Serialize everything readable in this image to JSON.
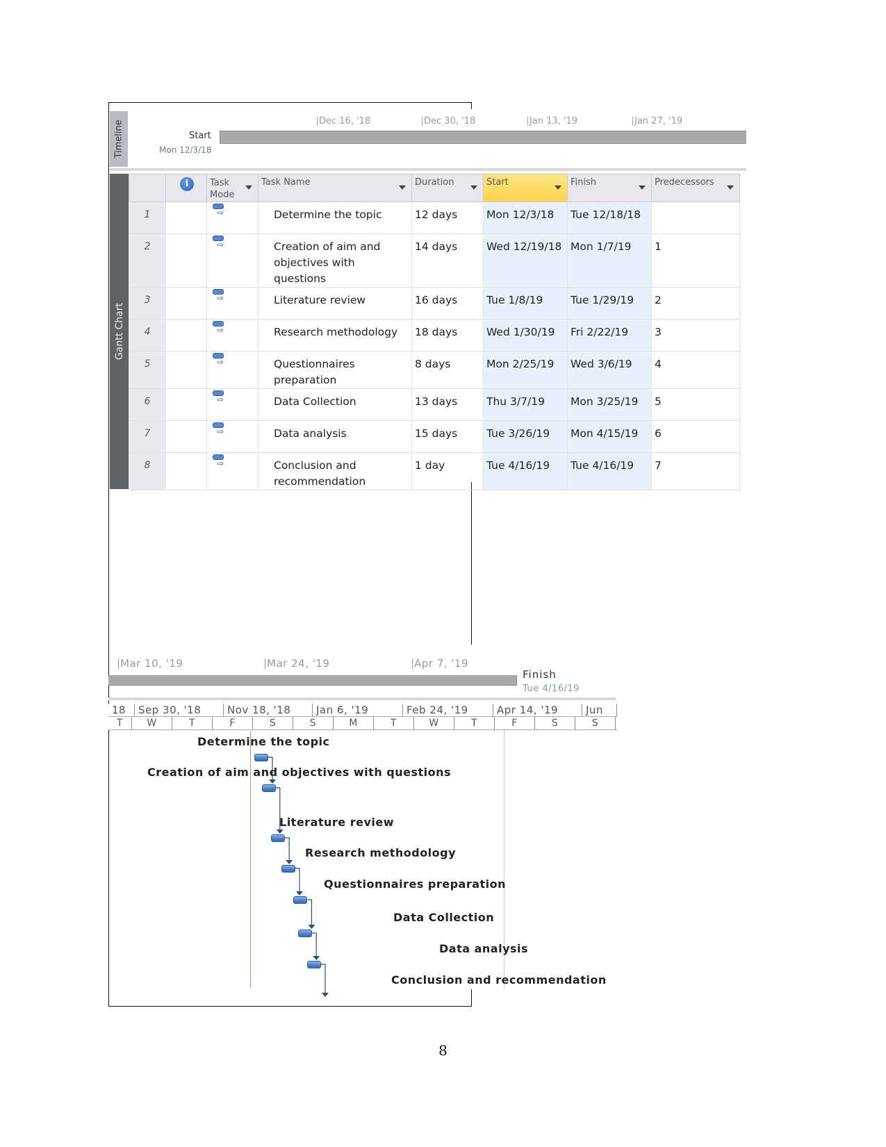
{
  "timeline": {
    "tab_label": "Timeline",
    "start_label": "Start",
    "start_date": "Mon 12/3/18",
    "ticks": [
      "Dec 16, '18",
      "Dec 30, '18",
      "Jan 13, '19",
      "Jan 27, '19"
    ],
    "lower_ticks": [
      "Mar 10, '19",
      "Mar 24, '19",
      "Apr 7, '19"
    ],
    "finish_label": "Finish",
    "finish_date": "Tue 4/16/19"
  },
  "gantt": {
    "tab_label": "Gantt Chart",
    "columns": {
      "info_icon": "i",
      "task_mode": "Task Mode",
      "task_name": "Task Name",
      "duration": "Duration",
      "start": "Start",
      "finish": "Finish",
      "predecessors": "Predecessors"
    },
    "rows": [
      {
        "id": "1",
        "name": "Determine the topic",
        "duration": "12 days",
        "start": "Mon 12/3/18",
        "finish": "Tue 12/18/18",
        "pred": ""
      },
      {
        "id": "2",
        "name": "Creation of aim and objectives with questions",
        "duration": "14 days",
        "start": "Wed 12/19/18",
        "finish": "Mon 1/7/19",
        "pred": "1"
      },
      {
        "id": "3",
        "name": "Literature review",
        "duration": "16 days",
        "start": "Tue 1/8/19",
        "finish": "Tue 1/29/19",
        "pred": "2"
      },
      {
        "id": "4",
        "name": "Research methodology",
        "duration": "18 days",
        "start": "Wed 1/30/19",
        "finish": "Fri 2/22/19",
        "pred": "3"
      },
      {
        "id": "5",
        "name": "Questionnaires preparation",
        "duration": "8 days",
        "start": "Mon 2/25/19",
        "finish": "Wed 3/6/19",
        "pred": "4"
      },
      {
        "id": "6",
        "name": "Data Collection",
        "duration": "13 days",
        "start": "Thu 3/7/19",
        "finish": "Mon 3/25/19",
        "pred": "5"
      },
      {
        "id": "7",
        "name": "Data analysis",
        "duration": "15 days",
        "start": "Tue 3/26/19",
        "finish": "Mon 4/15/19",
        "pred": "6"
      },
      {
        "id": "8",
        "name": "Conclusion and recommendation",
        "duration": "1 day",
        "start": "Tue 4/16/19",
        "finish": "Tue 4/16/19",
        "pred": "7"
      }
    ]
  },
  "chart": {
    "major_scale": [
      "18",
      "Sep 30, '18",
      "Nov 18, '18",
      "Jan 6, '19",
      "Feb 24, '19",
      "Apr 14, '19",
      "Jun"
    ],
    "minor_scale": [
      "T",
      "W",
      "T",
      "F",
      "S",
      "S",
      "M",
      "T",
      "W",
      "T",
      "F",
      "S",
      "S"
    ],
    "bar_labels": [
      "Determine the topic",
      "Creation of aim and objectives with questions",
      "Literature review",
      "Research methodology",
      "Questionnaires preparation",
      "Data Collection",
      "Data analysis",
      "Conclusion and recommendation"
    ]
  },
  "page_number": "8"
}
